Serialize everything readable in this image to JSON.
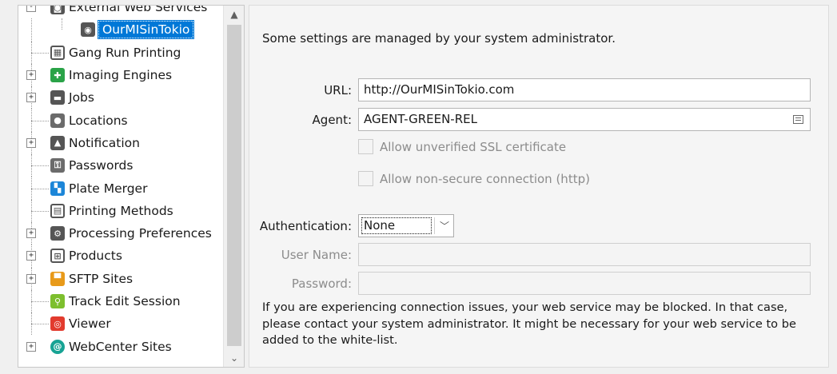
{
  "tree": {
    "items": [
      {
        "label": "External Web Services",
        "icon": "web-services-icon",
        "color": "#555555",
        "expander": "-"
      },
      {
        "label": "OurMISinTokio",
        "icon": "eye-icon",
        "color": "#555555",
        "selected": true
      },
      {
        "label": "Gang Run Printing",
        "icon": "grid-icon",
        "color": "#ffffff"
      },
      {
        "label": "Imaging Engines",
        "icon": "imaging-engines-icon",
        "color": "#2aa348",
        "expander": "+"
      },
      {
        "label": "Jobs",
        "icon": "folder-icon",
        "color": "#555555",
        "expander": "+"
      },
      {
        "label": "Locations",
        "icon": "location-pin-icon",
        "color": "#6b6b6b"
      },
      {
        "label": "Notification",
        "icon": "bell-icon",
        "color": "#555555",
        "expander": "+"
      },
      {
        "label": "Passwords",
        "icon": "key-icon",
        "color": "#6b6b6b"
      },
      {
        "label": "Plate Merger",
        "icon": "plate-merger-icon",
        "color": "#1c86d8"
      },
      {
        "label": "Printing Methods",
        "icon": "printer-icon",
        "color": "#ffffff"
      },
      {
        "label": "Processing Preferences",
        "icon": "gear-icon",
        "color": "#555555",
        "expander": "+"
      },
      {
        "label": "Products",
        "icon": "products-icon",
        "color": "#ffffff",
        "expander": "+"
      },
      {
        "label": "SFTP Sites",
        "icon": "sftp-icon",
        "color": "#e89a1a",
        "expander": "+"
      },
      {
        "label": "Track Edit Session",
        "icon": "magnifier-icon",
        "color": "#7dbf2e"
      },
      {
        "label": "Viewer",
        "icon": "viewer-icon",
        "color": "#e23b2e"
      },
      {
        "label": "WebCenter Sites",
        "icon": "webcenter-icon",
        "color": "#17a394",
        "expander": "+"
      }
    ]
  },
  "settings": {
    "admin_note": "Some settings are managed by your system administrator.",
    "url_label": "URL:",
    "url_value": "http://OurMISinTokio.com",
    "agent_label": "Agent:",
    "agent_value": "AGENT-GREEN-REL",
    "ssl_label": "Allow unverified SSL certificate",
    "http_label": "Allow non-secure connection (http)",
    "auth_label": "Authentication:",
    "auth_value": "None",
    "username_label": "User Name:",
    "username_value": "",
    "password_label": "Password:",
    "password_value": "",
    "info_text": "If you are experiencing connection issues, your web service may be blocked. In that case, please contact your system administrator. It might be necessary for your web service to be added to the white-list."
  },
  "colors": {
    "selection": "#0078d7",
    "disabled_text": "#8c8c8c"
  }
}
